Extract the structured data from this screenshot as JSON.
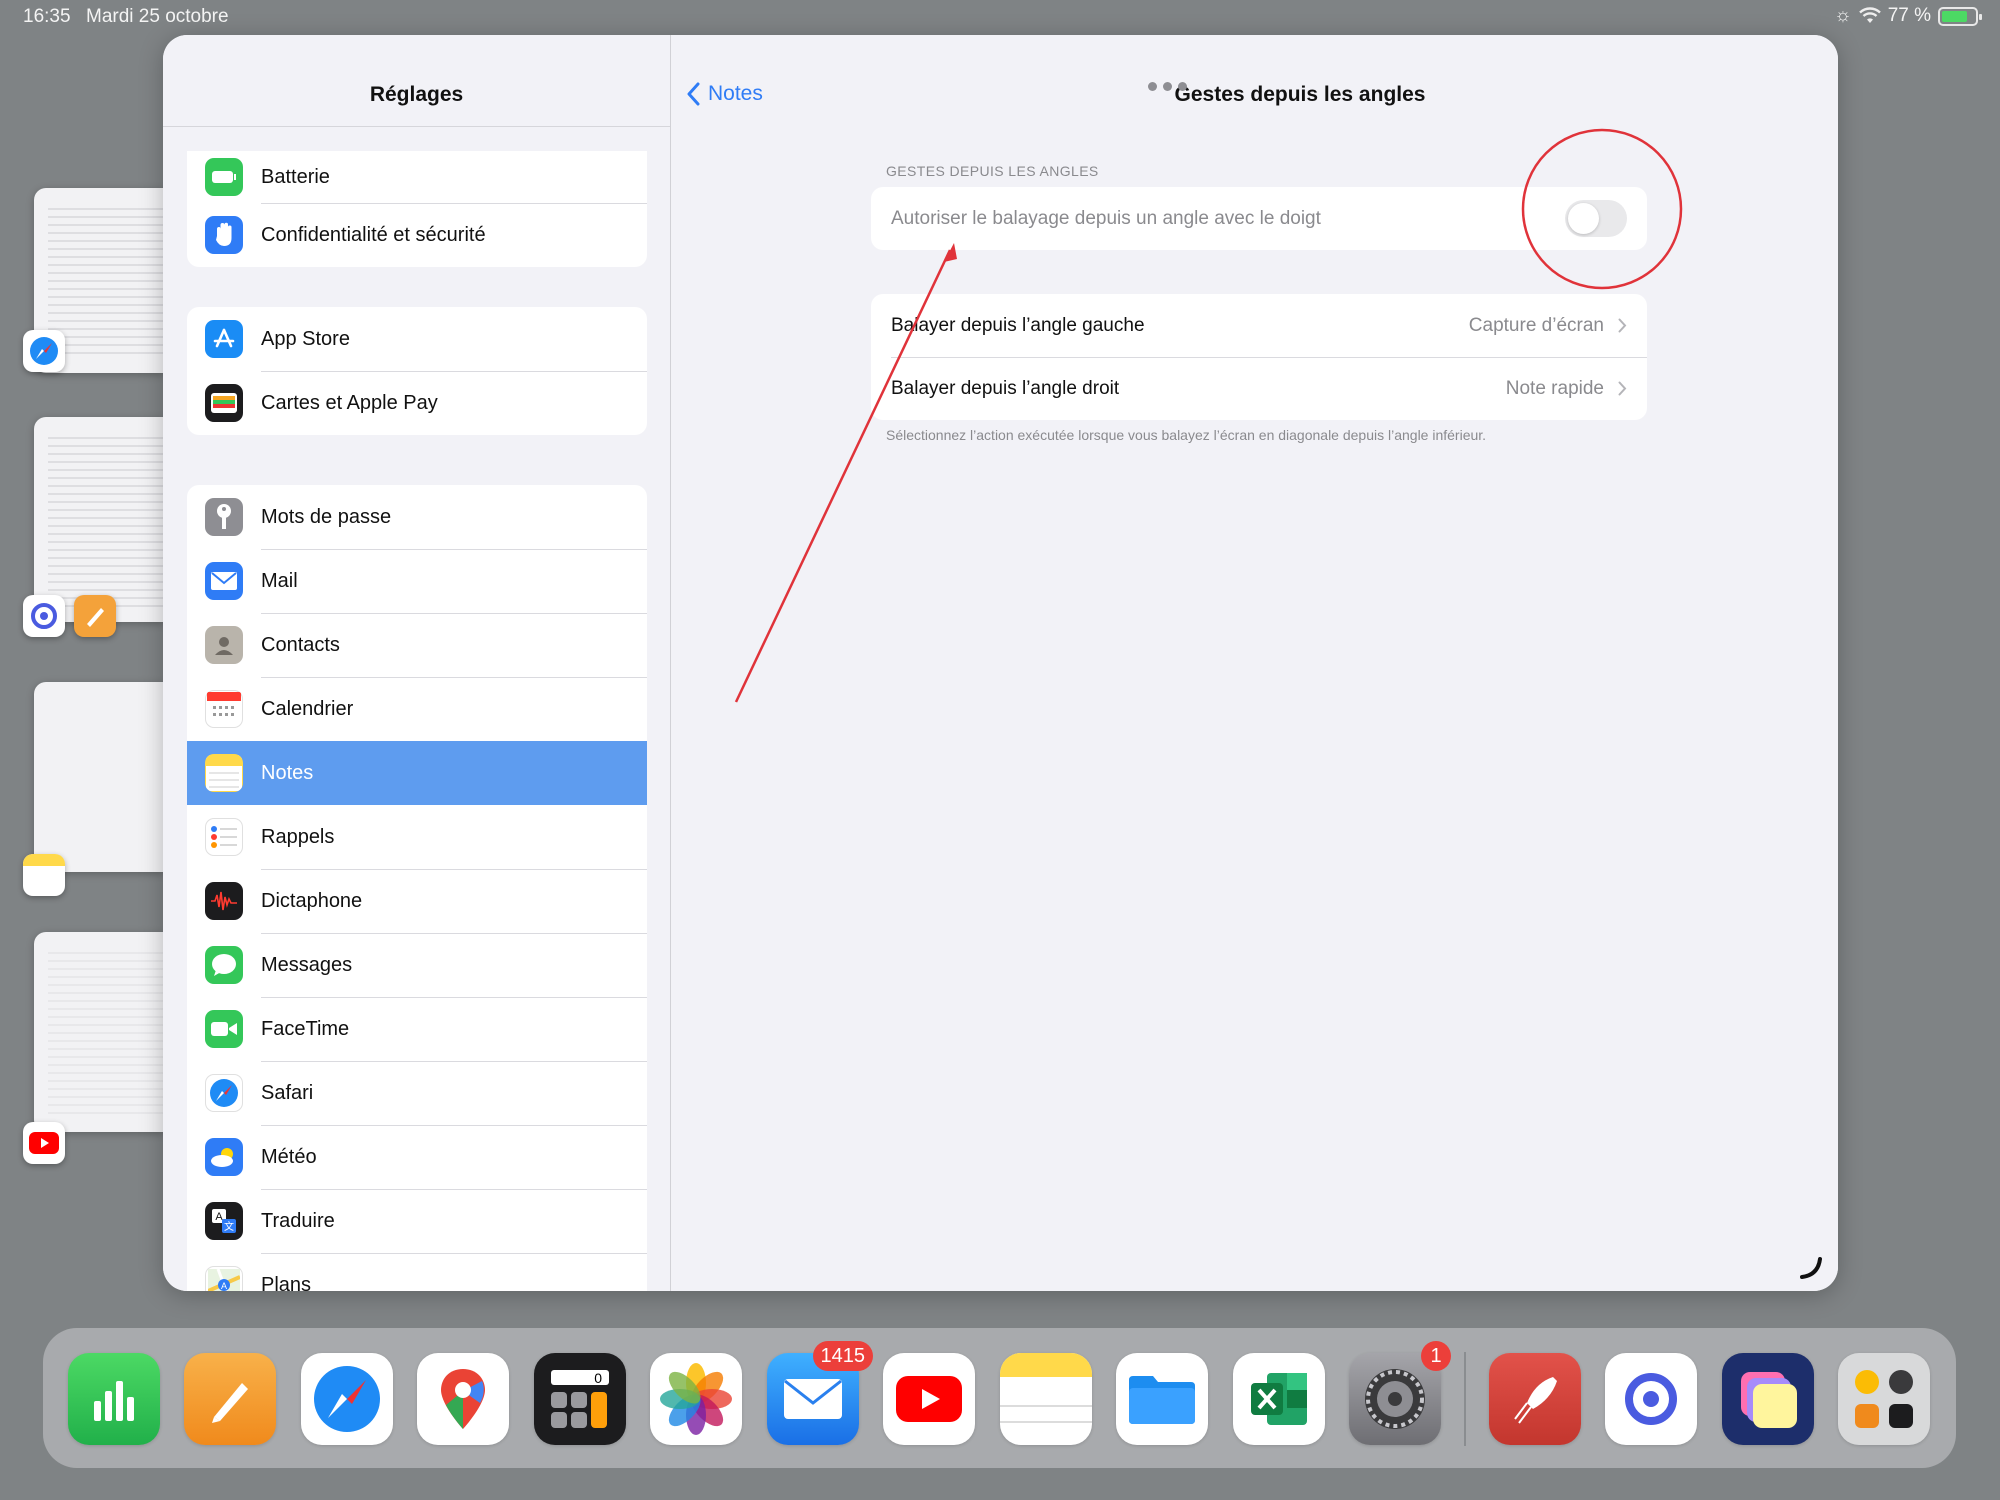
{
  "status_bar": {
    "time": "16:35",
    "date": "Mardi 25 octobre",
    "battery_text": "77 %",
    "battery_level": 0.77
  },
  "sidebar": {
    "title": "Réglages",
    "groups": [
      [
        {
          "label": "Batterie",
          "icon": "battery-icon",
          "color": "#34c759"
        },
        {
          "label": "Confidentialité et sécurité",
          "icon": "hand-icon",
          "color": "#2f7cf6"
        }
      ],
      [
        {
          "label": "App Store",
          "icon": "app-store-icon",
          "color": "#1a8cf5"
        },
        {
          "label": "Cartes et Apple Pay",
          "icon": "wallet-icon",
          "color": "#1c1c1e"
        }
      ],
      [
        {
          "label": "Mots de passe",
          "icon": "key-icon",
          "color": "#8e8e93"
        },
        {
          "label": "Mail",
          "icon": "mail-icon",
          "color": "#2f7cf6"
        },
        {
          "label": "Contacts",
          "icon": "contacts-icon",
          "color": "#b9b4ab"
        },
        {
          "label": "Calendrier",
          "icon": "calendar-icon",
          "color": "#ffffff"
        },
        {
          "label": "Notes",
          "icon": "notes-icon",
          "color": "#ffd94a",
          "selected": true
        },
        {
          "label": "Rappels",
          "icon": "reminders-icon",
          "color": "#ffffff"
        },
        {
          "label": "Dictaphone",
          "icon": "voice-memos-icon",
          "color": "#1c1c1e"
        },
        {
          "label": "Messages",
          "icon": "messages-icon",
          "color": "#34c759"
        },
        {
          "label": "FaceTime",
          "icon": "facetime-icon",
          "color": "#34c759"
        },
        {
          "label": "Safari",
          "icon": "safari-icon",
          "color": "#ffffff"
        },
        {
          "label": "Météo",
          "icon": "weather-icon",
          "color": "#2f7cf6"
        },
        {
          "label": "Traduire",
          "icon": "translate-icon",
          "color": "#1c1c1e"
        },
        {
          "label": "Plans",
          "icon": "maps-icon",
          "color": "#ffffff"
        }
      ]
    ]
  },
  "detail": {
    "back_label": "Notes",
    "title": "Gestes depuis les angles",
    "section_header": "GESTES DEPUIS LES ANGLES",
    "toggle_row": {
      "label": "Autoriser le balayage depuis un angle avec le doigt",
      "on": false
    },
    "rows": [
      {
        "label": "Balayer depuis l’angle gauche",
        "value": "Capture d’écran"
      },
      {
        "label": "Balayer depuis l’angle droit",
        "value": "Note rapide"
      }
    ],
    "footnote": "Sélectionnez l’action exécutée lorsque vous balayez l’écran en diagonale depuis l’angle inférieur."
  },
  "annotations": {
    "color": "#e0333a"
  },
  "dock": {
    "mail_badge": "1415",
    "settings_badge": "1",
    "apps": [
      "Numbers",
      "Pages",
      "Safari",
      "Google Maps",
      "Calculatrice",
      "Photos",
      "Mail",
      "YouTube",
      "Notes",
      "Fichiers",
      "Excel",
      "Réglages",
      "Rocket",
      "Screens",
      "Stage Manager",
      "Apps"
    ]
  }
}
